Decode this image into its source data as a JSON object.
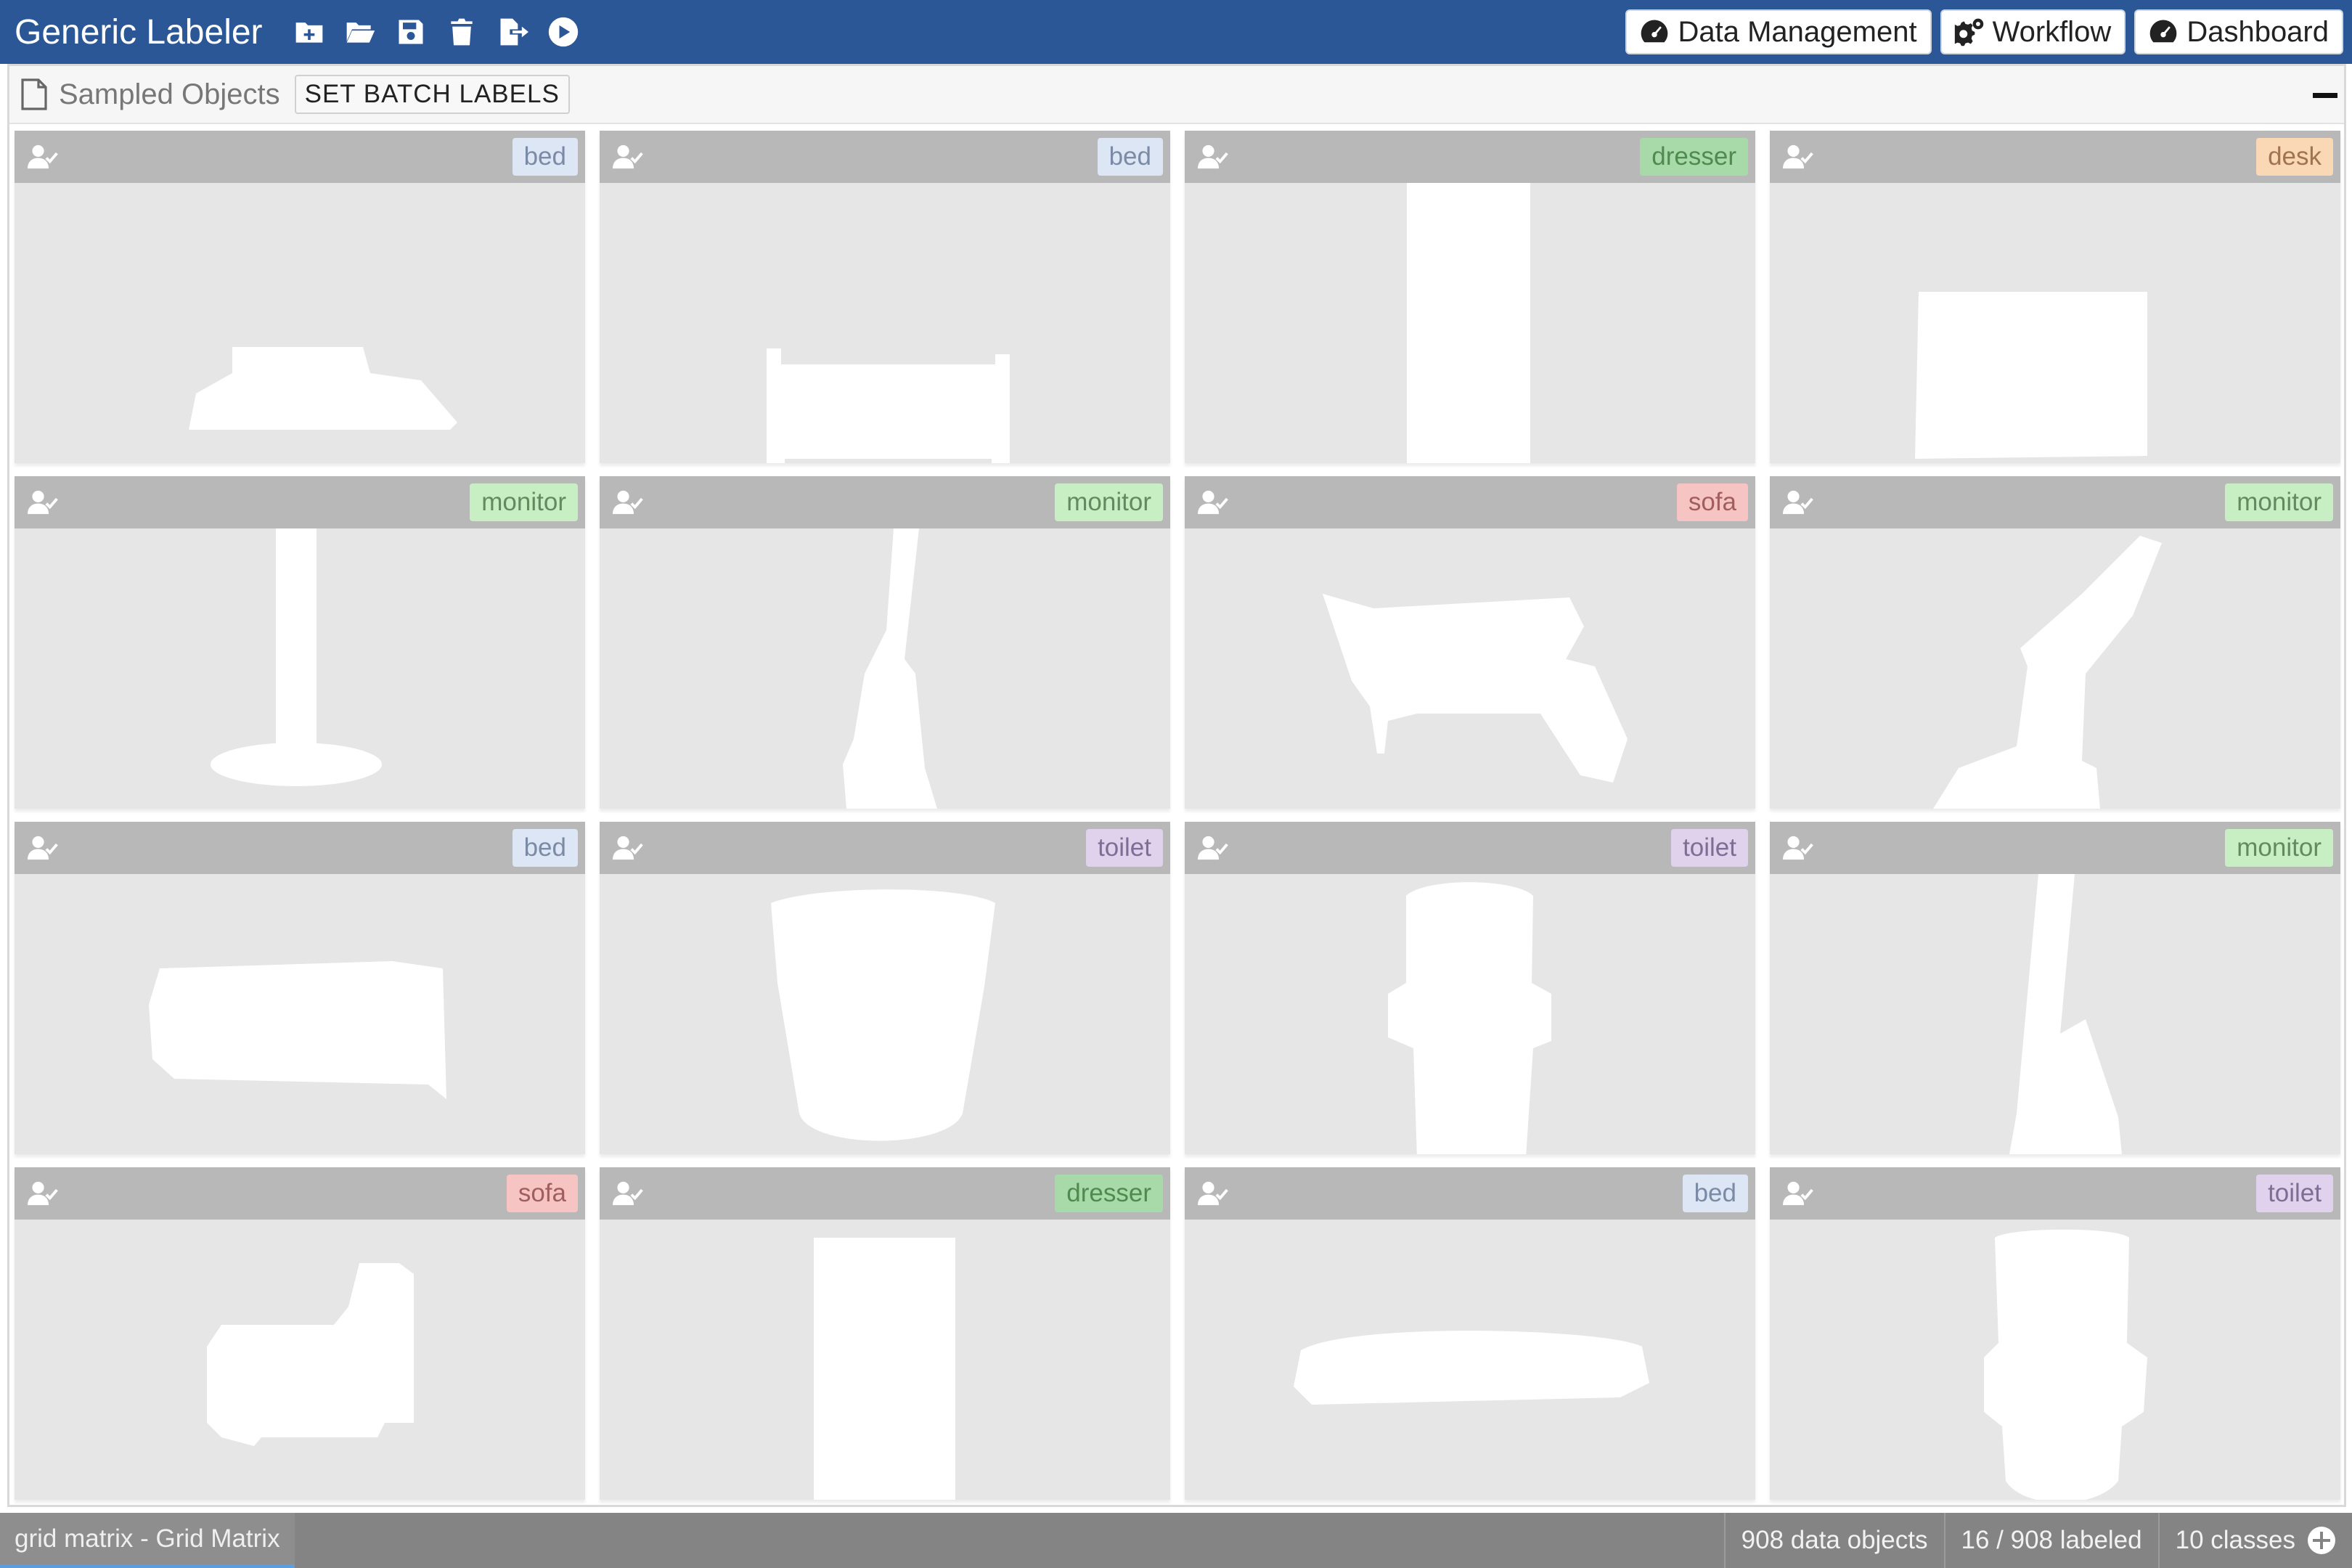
{
  "app": {
    "title": "Generic Labeler"
  },
  "toolbar": {
    "icons": [
      "new-file-icon",
      "open-folder-icon",
      "save-icon",
      "delete-icon",
      "export-icon",
      "play-icon"
    ]
  },
  "nav": {
    "data_management": "Data Management",
    "workflow": "Workflow",
    "dashboard": "Dashboard"
  },
  "panel": {
    "title": "Sampled Objects",
    "batch_button": "SET BATCH LABELS"
  },
  "grid": {
    "cells": [
      {
        "label": "bed",
        "shape": "bed-low"
      },
      {
        "label": "bed",
        "shape": "bed-frame"
      },
      {
        "label": "dresser",
        "shape": "dresser-tall"
      },
      {
        "label": "desk",
        "shape": "desk-box"
      },
      {
        "label": "monitor",
        "shape": "monitor-stand"
      },
      {
        "label": "monitor",
        "shape": "monitor-side"
      },
      {
        "label": "sofa",
        "shape": "sofa-chair"
      },
      {
        "label": "monitor",
        "shape": "monitor-slant"
      },
      {
        "label": "bed",
        "shape": "bed-block"
      },
      {
        "label": "toilet",
        "shape": "toilet-bucket"
      },
      {
        "label": "toilet",
        "shape": "toilet-front"
      },
      {
        "label": "monitor",
        "shape": "monitor-a"
      },
      {
        "label": "sofa",
        "shape": "sofa-small"
      },
      {
        "label": "dresser",
        "shape": "dresser-narrow"
      },
      {
        "label": "bed",
        "shape": "bed-flat"
      },
      {
        "label": "toilet",
        "shape": "toilet-front2"
      }
    ]
  },
  "status": {
    "tab": "grid matrix - Grid Matrix",
    "objects": "908 data objects",
    "labeled": "16 / 908 labeled",
    "classes": "10 classes"
  },
  "colors": {
    "topbar": "#2b5797",
    "cell_bg": "#e6e6e6",
    "cell_bar": "#b8b8b8",
    "statusbar": "#848484"
  }
}
